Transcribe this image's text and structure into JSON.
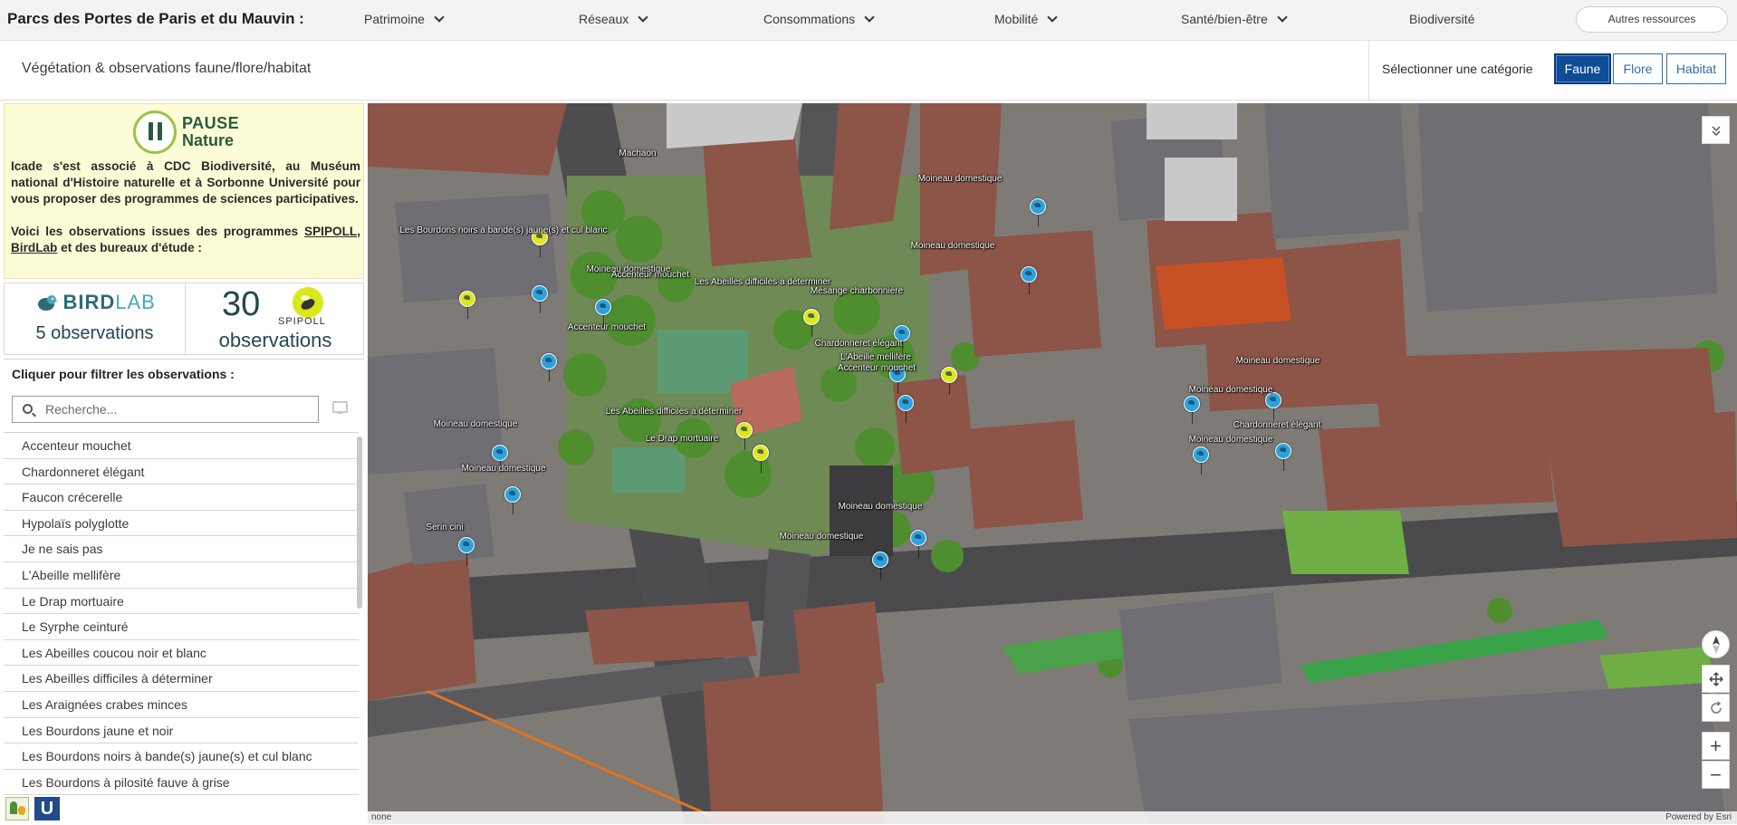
{
  "app": {
    "title": "Parcs des Portes de Paris et du Mauvin :",
    "nav": [
      {
        "label": "Patrimoine",
        "has_menu": true
      },
      {
        "label": "Réseaux",
        "has_menu": true
      },
      {
        "label": "Consommations",
        "has_menu": true
      },
      {
        "label": "Mobilité",
        "has_menu": true
      },
      {
        "label": "Santé/bien-être",
        "has_menu": true
      },
      {
        "label": "Biodiversité",
        "has_menu": false
      }
    ],
    "resources_button": "Autres ressources"
  },
  "subheader": {
    "title": "Végétation & observations faune/flore/habitat",
    "category_label": "Sélectionner une catégorie",
    "categories": [
      "Faune",
      "Flore",
      "Habitat"
    ],
    "active_category": "Faune"
  },
  "info": {
    "logo_line1": "PAUSE",
    "logo_line2": "Nature",
    "paragraph1": "Icade s'est associé à CDC Biodiversité, au Muséum national d'Histoire naturelle et à Sorbonne Université pour vous proposer des programmes de sciences participatives.",
    "p2_before": "Voici les observations issues des programmes ",
    "link_spipoll": "SPIPOLL",
    "p2_comma": ", ",
    "link_birdlab": "BirdLab",
    "p2_after": " et des bureaux d'étude :"
  },
  "stats": {
    "birdlab_brand_a": "BIRD",
    "birdlab_brand_b": "LAB",
    "birdlab_count": "5 observations",
    "spipoll_number": "30",
    "spipoll_brand": "SPIPOLL",
    "spipoll_label": "observations"
  },
  "filter": {
    "title": "Cliquer pour filtrer les observations :",
    "search_placeholder": "Recherche...",
    "items": [
      "Accenteur mouchet",
      "Chardonneret élégant",
      "Faucon crécerelle",
      "Hypolaïs polyglotte",
      "Je ne sais pas",
      "L'Abeille mellifère",
      "Le Drap mortuaire",
      "Le Syrphe ceinturé",
      "Les Abeilles coucou noir et blanc",
      "Les Abeilles difficiles à déterminer",
      "Les Araignées crabes minces",
      "Les Bourdons jaune et noir",
      "Les Bourdons noirs à bande(s) jaune(s) et cul blanc",
      "Les Bourdons à pilosité fauve à grise"
    ]
  },
  "map": {
    "labels": [
      {
        "text": "Machaon",
        "type": "insect"
      },
      {
        "text": "Les Bourdons noirs à bande(s) jaune(s) et cul blanc",
        "type": "insect"
      },
      {
        "text": "Moineau domestique",
        "type": "bird"
      },
      {
        "text": "Accenteur mouchet",
        "type": "bird"
      },
      {
        "text": "Les Abeilles difficiles à déterminer",
        "type": "insect"
      },
      {
        "text": "Mésange charbonnière",
        "type": "bird"
      },
      {
        "text": "Moineau domestique",
        "type": "bird"
      },
      {
        "text": "Moineau domestique",
        "type": "bird"
      },
      {
        "text": "Accenteur mouchet",
        "type": "bird"
      },
      {
        "text": "Chardonneret élégant",
        "type": "bird"
      },
      {
        "text": "L'Abeille mellifère",
        "type": "insect"
      },
      {
        "text": "Accenteur mouchet",
        "type": "bird"
      },
      {
        "text": "Les Abeilles difficiles à déterminer",
        "type": "insect"
      },
      {
        "text": "Le Drap mortuaire",
        "type": "insect"
      },
      {
        "text": "Moineau domestique",
        "type": "bird"
      },
      {
        "text": "Moineau domestique",
        "type": "bird"
      },
      {
        "text": "Serin cini",
        "type": "bird"
      },
      {
        "text": "Moineau domestique",
        "type": "bird"
      },
      {
        "text": "Moineau domestique",
        "type": "bird"
      },
      {
        "text": "Moineau domestique",
        "type": "bird"
      },
      {
        "text": "Moineau domestique",
        "type": "bird"
      },
      {
        "text": "Chardonneret élégant",
        "type": "bird"
      },
      {
        "text": "Moineau domestique",
        "type": "bird"
      }
    ],
    "attribution": "none",
    "powered_by": "Powered by Esri",
    "colors": {
      "bird_pin": "#2aa3dc",
      "insect_pin": "#dfe61b",
      "active_button": "#0e4c96"
    }
  }
}
